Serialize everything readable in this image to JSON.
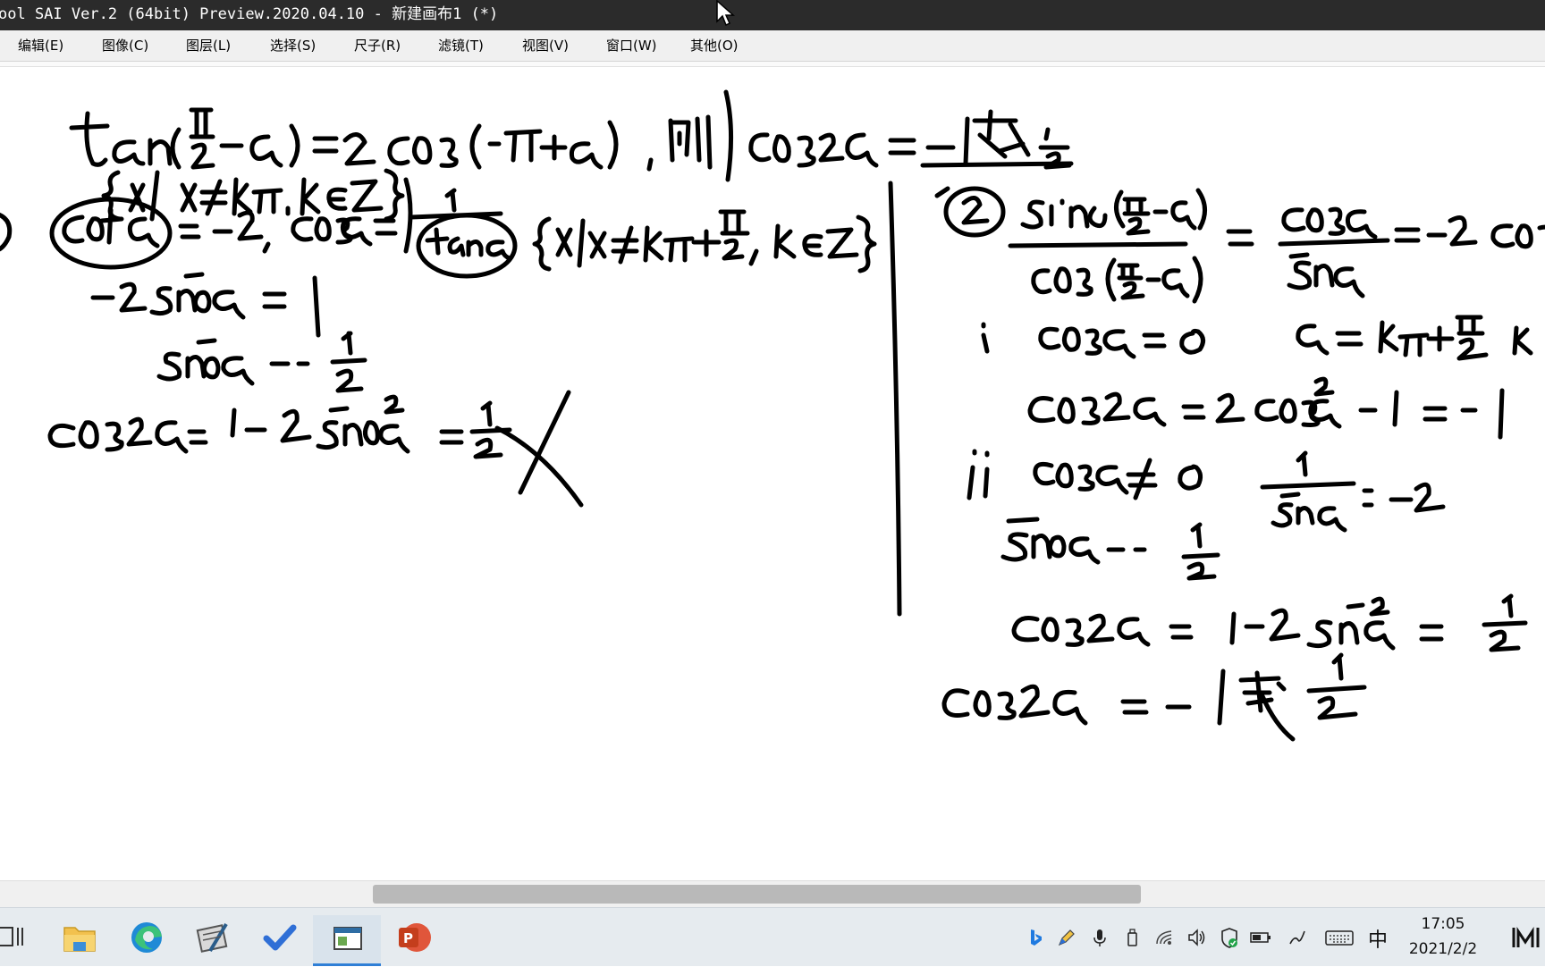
{
  "window": {
    "title": "ool SAI Ver.2 (64bit) Preview.2020.04.10 - 新建画布1 (*)"
  },
  "menu": {
    "items": [
      {
        "label": "编辑(E)"
      },
      {
        "label": "图像(C)"
      },
      {
        "label": "图层(L)"
      },
      {
        "label": "选择(S)"
      },
      {
        "label": "尺子(R)"
      },
      {
        "label": "滤镜(T)"
      },
      {
        "label": "视图(V)"
      },
      {
        "label": "窗口(W)"
      },
      {
        "label": "其他(O)"
      }
    ]
  },
  "taskbar": {
    "apps": [
      {
        "icon": "task-view-icon"
      },
      {
        "icon": "file-explorer-icon"
      },
      {
        "icon": "edge-browser-icon"
      },
      {
        "icon": "paint-tool-icon"
      },
      {
        "icon": "todo-check-icon"
      },
      {
        "icon": "sai-window-icon",
        "active": true
      },
      {
        "icon": "powerpoint-icon"
      }
    ],
    "tray": {
      "icons": [
        "bing-icon",
        "pen-icon",
        "microphone-icon",
        "usb-drive-icon",
        "wifi-icon",
        "volume-icon",
        "security-shield-icon",
        "battery-icon",
        "ink-icon",
        "keyboard-icon"
      ],
      "ime": "中",
      "time": "17:05",
      "date": "2021/2/2"
    },
    "accent": "#2f7fd6"
  },
  "colors": {
    "titlebar": "#2b2b2b",
    "menubar": "#f0f0f0",
    "canvas": "#ffffff",
    "ink": "#000000"
  }
}
